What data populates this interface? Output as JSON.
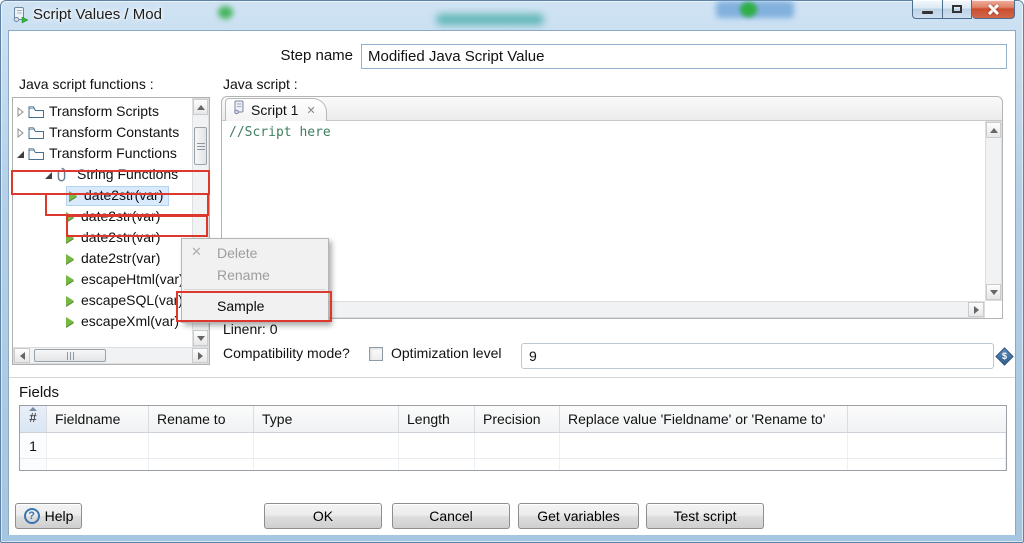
{
  "window": {
    "title": "Script Values / Mod"
  },
  "header": {
    "step_name_label": "Step name",
    "step_name_value": "Modified Java Script Value"
  },
  "left_panel": {
    "label": "Java script functions :",
    "tree_items": [
      {
        "label": "Transform Scripts"
      },
      {
        "label": "Transform Constants"
      },
      {
        "label": "Transform Functions"
      },
      {
        "label": "String Functions"
      },
      {
        "label": "date2str(var)"
      },
      {
        "label": "date2str(var)"
      },
      {
        "label": "date2str(var)"
      },
      {
        "label": "date2str(var)"
      },
      {
        "label": "escapeHtml(var)"
      },
      {
        "label": "escapeSQL(var)"
      },
      {
        "label": "escapeXml(var)"
      }
    ]
  },
  "script_panel": {
    "label": "Java script :",
    "tab_title": "Script 1",
    "code": "//Script here",
    "linenr_text": "Linenr: 0",
    "compatibility_label": "Compatibility mode?",
    "optimization_label": "Optimization level",
    "optimization_value": "9"
  },
  "context_menu": {
    "delete_label": "Delete",
    "rename_label": "Rename",
    "sample_label": "Sample"
  },
  "fields_section": {
    "label": "Fields",
    "columns": [
      "#",
      "Fieldname",
      "Rename to",
      "Type",
      "Length",
      "Precision",
      "Replace value 'Fieldname' or 'Rename to'"
    ],
    "rows": [
      {
        "num": "1",
        "fieldname": "",
        "rename_to": "",
        "type": "",
        "length": "",
        "precision": "",
        "replace_value": ""
      }
    ]
  },
  "footer": {
    "help_label": "Help",
    "ok_label": "OK",
    "cancel_label": "Cancel",
    "get_variables_label": "Get variables",
    "test_script_label": "Test script"
  },
  "icons": {
    "tab_close": "✕",
    "menu_delete": "✕",
    "help_qmark": "?",
    "variable_dollar": "$"
  },
  "colors": {
    "annotation_red": "#dd382d",
    "comment_green": "#3f7f5f",
    "selection_blue": "#d9eafc",
    "titlebar_blue": "#b4d0e8"
  }
}
